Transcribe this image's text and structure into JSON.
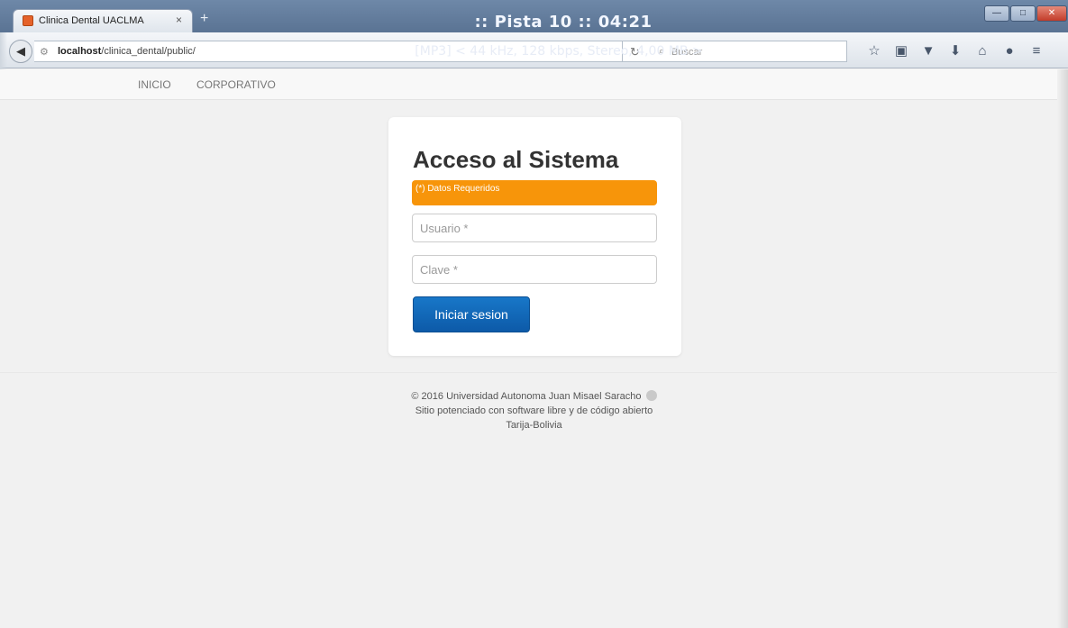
{
  "browser": {
    "tab_title": "Clinica Dental UACLMA",
    "tab_close": "×",
    "new_tab": "+",
    "url_host": "localhost",
    "url_path": "/clinica_dental/public/",
    "search_placeholder": "Buscar",
    "window_buttons": {
      "minimize": "—",
      "maximize": "□",
      "close": "✕"
    },
    "toolbar_icons": [
      "star-icon",
      "clipboard-icon",
      "pocket-icon",
      "download-icon",
      "home-icon",
      "chat-icon",
      "menu-icon"
    ]
  },
  "media_overlay": {
    "title": ":: Pista 10 :: 04:21",
    "info": "[MP3] < 44 kHz, 128 kbps, Stereo, 4,00 MB >"
  },
  "site_nav": {
    "items": [
      "INICIO",
      "CORPORATIVO"
    ]
  },
  "login": {
    "title": "Acceso al Sistema",
    "required_note": "(*) Datos Requeridos",
    "username_placeholder": "Usuario *",
    "password_placeholder": "Clave *",
    "submit_label": "Iniciar sesion"
  },
  "footer": {
    "line1": "© 2016 Universidad Autonoma Juan Misael Saracho",
    "line2": "Sitio potenciado con software libre y de código abierto",
    "line3": "Tarija-Bolivia"
  },
  "colors": {
    "accent_button": "#0d5aa8",
    "required_bar": "#f7950a",
    "page_bg": "#f1f1f1"
  }
}
